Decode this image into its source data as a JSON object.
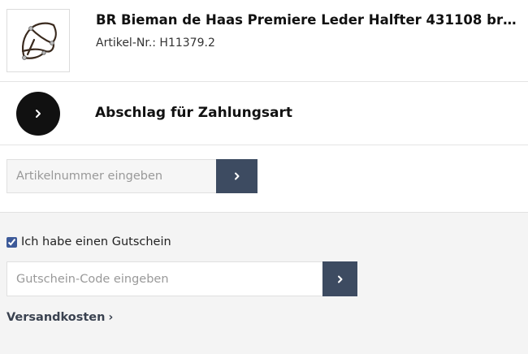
{
  "product": {
    "title": "BR Bieman de Haas Premiere Leder Halfter 431108 braun...",
    "sku": "Artikel-Nr.: H11379.2",
    "image_icon": "halter-image"
  },
  "payment_fee": {
    "label": "Abschlag für Zahlungsart",
    "icon": "chevron-right-icon"
  },
  "sku_entry": {
    "placeholder": "Artikelnummer eingeben",
    "value": "",
    "button_icon": "chevron-right-icon"
  },
  "voucher": {
    "checkbox_label": "Ich habe einen Gutschein",
    "checked": true,
    "placeholder": "Gutschein-Code eingeben",
    "value": "",
    "button_icon": "chevron-right-icon"
  },
  "shipping": {
    "label": "Versandkosten",
    "chevron": "›"
  },
  "colors": {
    "button_bg": "#3d4b61",
    "fee_circle": "#111111",
    "panel_bg": "#f4f4f4"
  }
}
